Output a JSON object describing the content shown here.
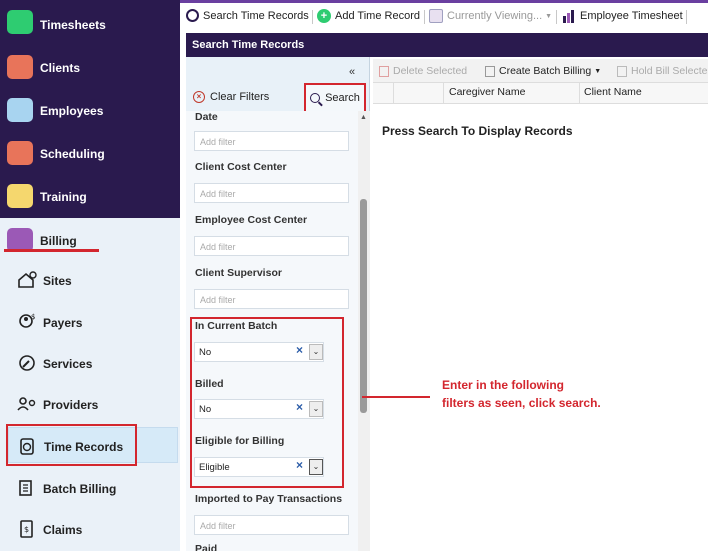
{
  "nav": {
    "items": [
      {
        "label": "Timesheets",
        "color": "#2ecc71"
      },
      {
        "label": "Clients",
        "color": "#e8745a"
      },
      {
        "label": "Employees",
        "color": "#a8d4f0"
      },
      {
        "label": "Scheduling",
        "color": "#e8745a"
      },
      {
        "label": "Training",
        "color": "#f5d76e"
      }
    ],
    "billing_label": "Billing",
    "sub_items": [
      {
        "label": "Sites",
        "icon": "house-gear-icon"
      },
      {
        "label": "Payers",
        "icon": "person-dollar-icon"
      },
      {
        "label": "Services",
        "icon": "wrench-icon"
      },
      {
        "label": "Providers",
        "icon": "person-key-icon"
      },
      {
        "label": "Time Records",
        "icon": "clipboard-clock-icon"
      },
      {
        "label": "Batch Billing",
        "icon": "document-stack-icon"
      },
      {
        "label": "Claims",
        "icon": "document-dollar-icon"
      }
    ]
  },
  "topbar": {
    "search_time_records": "Search Time Records",
    "add_time_record": "Add Time Record",
    "currently_viewing": "Currently Viewing...",
    "employee_timesheet": "Employee Timesheet"
  },
  "panel": {
    "title": "Search Time Records"
  },
  "filters": {
    "collapse": "«",
    "clear_filters": "Clear Filters",
    "search": "Search",
    "placeholder": "Add filter",
    "date": "Date",
    "client_cost_center": "Client Cost Center",
    "employee_cost_center": "Employee Cost Center",
    "client_supervisor": "Client Supervisor",
    "in_current_batch": "In Current Batch",
    "in_current_batch_value": "No",
    "billed": "Billed",
    "billed_value": "No",
    "eligible_for_billing": "Eligible for Billing",
    "eligible_for_billing_value": "Eligible",
    "imported_to_pay": "Imported to Pay Transactions",
    "paid": "Paid"
  },
  "grid": {
    "delete_selected": "Delete Selected",
    "create_batch_billing": "Create Batch Billing",
    "hold_bill_selected": "Hold Bill Selecte",
    "col_caregiver": "Caregiver Name",
    "col_client": "Client Name",
    "empty_message": "Press Search To Display Records"
  },
  "annotation": {
    "line1": "Enter in the following",
    "line2": "filters as seen, click search."
  }
}
